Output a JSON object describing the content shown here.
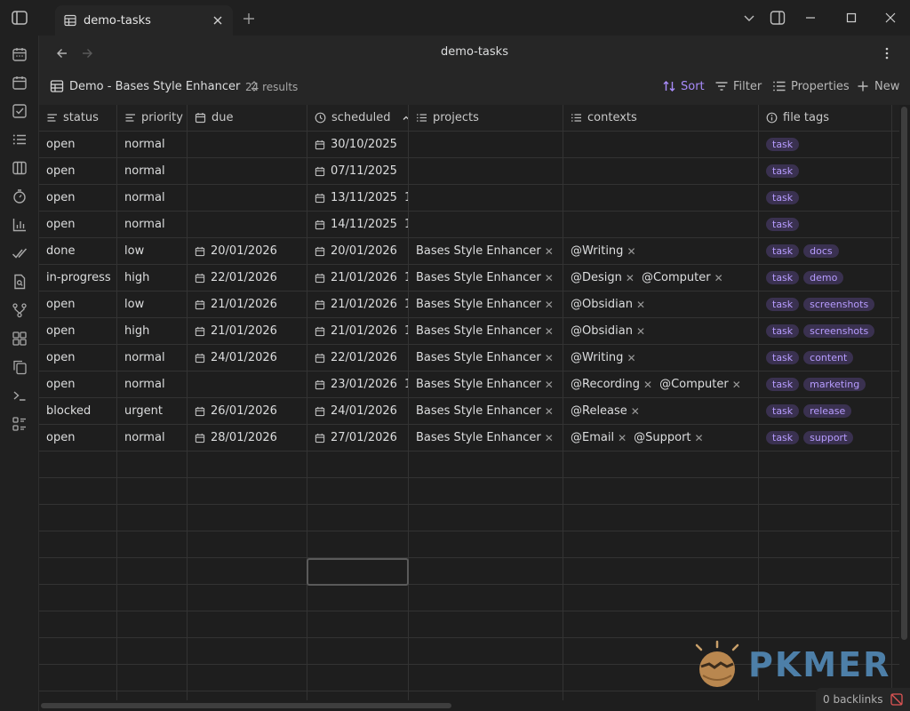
{
  "tab": {
    "title": "demo-tasks"
  },
  "view": {
    "title": "demo-tasks"
  },
  "toolbar": {
    "view_name": "Demo - Bases Style Enhancer",
    "results": "24 results",
    "sort": "Sort",
    "filter": "Filter",
    "properties": "Properties",
    "new": "New"
  },
  "columns": [
    {
      "key": "status",
      "label": "status",
      "icon": "list-lines-icon"
    },
    {
      "key": "priority",
      "label": "priority",
      "icon": "list-lines-icon"
    },
    {
      "key": "due",
      "label": "due",
      "icon": "calendar-icon"
    },
    {
      "key": "scheduled",
      "label": "scheduled",
      "icon": "clock-icon"
    },
    {
      "key": "projects",
      "label": "projects",
      "icon": "list-icon"
    },
    {
      "key": "contexts",
      "label": "contexts",
      "icon": "list-icon"
    },
    {
      "key": "file_tags",
      "label": "file tags",
      "icon": "info-icon"
    }
  ],
  "rows": [
    {
      "status": "open",
      "priority": "normal",
      "due": "",
      "scheduled": "30/10/2025",
      "sched_extra": "",
      "projects": [],
      "contexts": [],
      "tags": [
        "task"
      ],
      "more": ""
    },
    {
      "status": "open",
      "priority": "normal",
      "due": "",
      "scheduled": "07/11/2025",
      "sched_extra": "",
      "projects": [],
      "contexts": [],
      "tags": [
        "task"
      ],
      "more": ""
    },
    {
      "status": "open",
      "priority": "normal",
      "due": "",
      "scheduled": "13/11/2025",
      "sched_extra": "1",
      "projects": [],
      "contexts": [],
      "tags": [
        "task"
      ],
      "more": ""
    },
    {
      "status": "open",
      "priority": "normal",
      "due": "",
      "scheduled": "14/11/2025",
      "sched_extra": "1",
      "projects": [],
      "contexts": [],
      "tags": [
        "task"
      ],
      "more": ""
    },
    {
      "status": "done",
      "priority": "low",
      "due": "20/01/2026",
      "scheduled": "20/01/2026",
      "sched_extra": "",
      "projects": [
        "Bases Style Enhancer"
      ],
      "contexts": [
        "@Writing"
      ],
      "tags": [
        "task",
        "docs"
      ],
      "more": ""
    },
    {
      "status": "in-progress",
      "priority": "high",
      "due": "22/01/2026",
      "scheduled": "21/01/2026",
      "sched_extra": "1",
      "projects": [
        "Bases Style Enhancer"
      ],
      "contexts": [
        "@Design",
        "@Computer"
      ],
      "tags": [
        "task",
        "demo"
      ],
      "more": ""
    },
    {
      "status": "open",
      "priority": "low",
      "due": "21/01/2026",
      "scheduled": "21/01/2026",
      "sched_extra": "1",
      "projects": [
        "Bases Style Enhancer"
      ],
      "contexts": [
        "@Obsidian"
      ],
      "tags": [
        "task",
        "screenshots"
      ],
      "more": "I"
    },
    {
      "status": "open",
      "priority": "high",
      "due": "21/01/2026",
      "scheduled": "21/01/2026",
      "sched_extra": "1",
      "projects": [
        "Bases Style Enhancer"
      ],
      "contexts": [
        "@Obsidian"
      ],
      "tags": [
        "task",
        "screenshots"
      ],
      "more": "I"
    },
    {
      "status": "open",
      "priority": "normal",
      "due": "24/01/2026",
      "scheduled": "22/01/2026",
      "sched_extra": "",
      "projects": [
        "Bases Style Enhancer"
      ],
      "contexts": [
        "@Writing"
      ],
      "tags": [
        "task",
        "content"
      ],
      "more": ""
    },
    {
      "status": "open",
      "priority": "normal",
      "due": "",
      "scheduled": "23/01/2026",
      "sched_extra": "1",
      "projects": [
        "Bases Style Enhancer"
      ],
      "contexts": [
        "@Recording",
        "@Computer"
      ],
      "tags": [
        "task",
        "marketing"
      ],
      "more": ""
    },
    {
      "status": "blocked",
      "priority": "urgent",
      "due": "26/01/2026",
      "scheduled": "24/01/2026",
      "sched_extra": "",
      "projects": [
        "Bases Style Enhancer"
      ],
      "contexts": [
        "@Release"
      ],
      "tags": [
        "task",
        "release"
      ],
      "more": "I"
    },
    {
      "status": "open",
      "priority": "normal",
      "due": "28/01/2026",
      "scheduled": "27/01/2026",
      "sched_extra": "",
      "projects": [
        "Bases Style Enhancer"
      ],
      "contexts": [
        "@Email",
        "@Support"
      ],
      "tags": [
        "task",
        "support"
      ],
      "more": ""
    }
  ],
  "watermark": {
    "text": "PKMER"
  },
  "status_bar": {
    "backlinks": "0 backlinks"
  },
  "colors": {
    "accent": "#a88bfa",
    "tag_bg": "#3a3150",
    "tag_text": "#b79cff",
    "watermark": "#4d7fa8"
  }
}
